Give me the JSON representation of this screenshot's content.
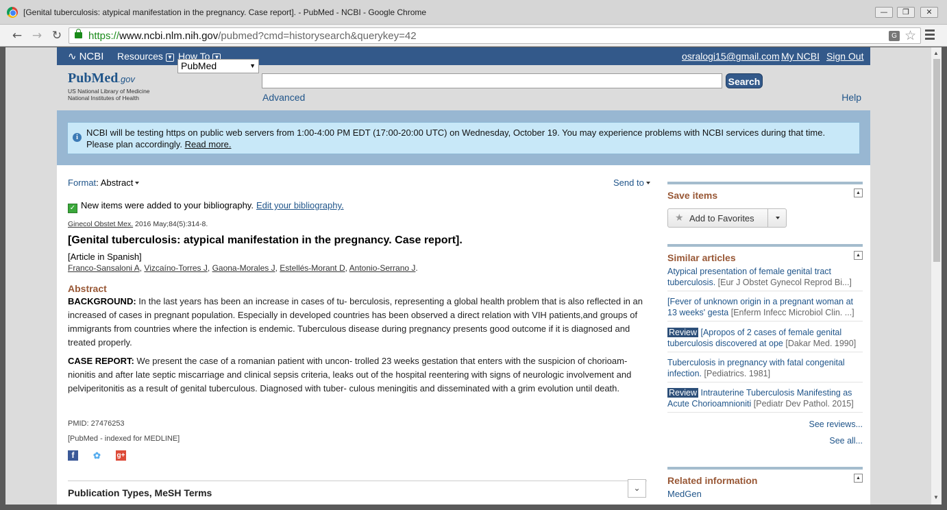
{
  "window": {
    "title": "[Genital tuberculosis: atypical manifestation in the pregnancy. Case report]. - PubMed - NCBI - Google Chrome"
  },
  "browser": {
    "url_scheme": "https://",
    "url_host": "www.ncbi.nlm.nih.gov",
    "url_path": "/pubmed?cmd=historysearch&querykey=42"
  },
  "ncbi_bar": {
    "logo": "NCBI",
    "resources": "Resources",
    "howto": "How To",
    "user_email": "osralogi15@gmail.com",
    "my_ncbi": "My NCBI",
    "sign_out": "Sign Out"
  },
  "header": {
    "logo_pub": "Pub",
    "logo_med": "Med",
    "logo_gov": ".gov",
    "logo_sub1": "US National Library of Medicine",
    "logo_sub2": "National Institutes of Health",
    "db_selected": "PubMed",
    "search_value": "",
    "search_button": "Search",
    "advanced": "Advanced",
    "help": "Help"
  },
  "notice": {
    "text": "NCBI will be testing https on public web servers from 1:00-4:00 PM EDT (17:00-20:00 UTC) on Wednesday, October 19. You may experience problems with NCBI services during that time. Please plan accordingly. ",
    "link": "Read more."
  },
  "article": {
    "format_label": "Format",
    "format_value": "Abstract",
    "send_to": "Send to",
    "bib_message": "New items were added to your bibliography.",
    "bib_link": "Edit your bibliography.",
    "journal": "Ginecol Obstet Mex.",
    "citation_rest": " 2016 May;84(5):314-8.",
    "title": "[Genital tuberculosis: atypical manifestation in the pregnancy. Case report].",
    "language": "[Article in Spanish]",
    "authors": [
      "Franco-Sansaloni A",
      "Vizcaíno-Torres J",
      "Gaona-Morales J",
      "Estellés-Morant D",
      "Antonio-Serrano J"
    ],
    "abstract_heading": "Abstract",
    "background_label": "BACKGROUND:",
    "background_text": " In the last years has been an increase in cases of tu- berculosis, representing a global health problem that is also reflected in an increased of cases in pregnant population. Especially in developed countries has been observed a direct relation with VIH patients,and groups of immigrants from countries where the infection is endemic. Tuberculous disease during pregnancy presents good outcome if it is diagnosed and treated properly.",
    "case_label": "CASE REPORT:",
    "case_text": " We present the case of a romanian patient with uncon- trolled 23 weeks gestation that enters with the suspicion of chorioam- nionitis and after late septic miscarriage and clinical sepsis criteria, leaks out of the hospital reentering with signs of neurologic involvement and pelviperitonitis as a result of genital tuberculous. Diagnosed with tuber- culous meningitis and disseminated with a grim evolution until death.",
    "pmid": "PMID: 27476253",
    "indexed": "[PubMed - indexed for MEDLINE]",
    "pub_types": "Publication Types, MeSH Terms"
  },
  "sidebar": {
    "save_items": "Save items",
    "add_favorites": "Add to Favorites",
    "similar_articles": "Similar articles",
    "similar": [
      {
        "badge": "",
        "title": "Atypical presentation of female genital tract tuberculosis.",
        "src": "[Eur J Obstet Gynecol Reprod Bi...]"
      },
      {
        "badge": "",
        "title": "[Fever of unknown origin in a pregnant woman at 13 weeks' gesta",
        "src": "[Enferm Infecc Microbiol Clin. ...]"
      },
      {
        "badge": "Review",
        "title": " [Apropos of 2 cases of female genital tuberculosis discovered at ope",
        "src": "[Dakar Med. 1990]"
      },
      {
        "badge": "",
        "title": "Tuberculosis in pregnancy with fatal congenital infection.",
        "src": "[Pediatrics. 1981]"
      },
      {
        "badge": "Review",
        "title": " Intrauterine Tuberculosis Manifesting as Acute Chorioamnioniti",
        "src": "[Pediatr Dev Pathol. 2015]"
      }
    ],
    "see_reviews": "See reviews...",
    "see_all": "See all...",
    "related_info": "Related information",
    "medgen": "MedGen"
  }
}
